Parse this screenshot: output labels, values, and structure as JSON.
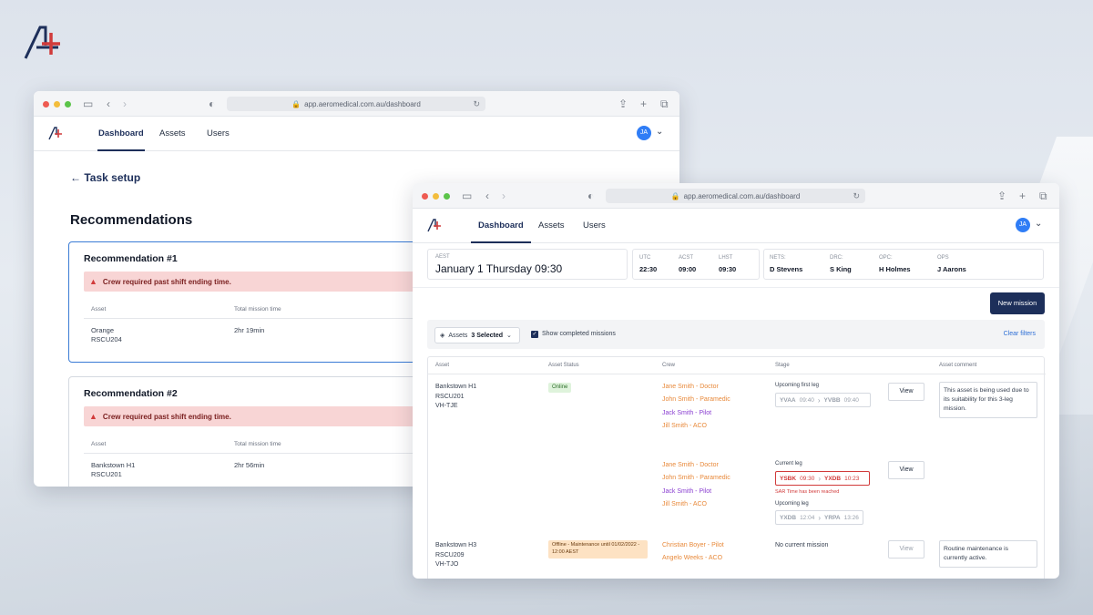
{
  "background": {
    "accent": "#1d2f5a",
    "brand_red": "#d13b3b"
  },
  "brand": {
    "logo_icon": "aeromedical-logo"
  },
  "back_window": {
    "url": "app.aeromedical.com.au/dashboard",
    "nav": {
      "tabs": [
        "Dashboard",
        "Assets",
        "Users"
      ],
      "active": "Dashboard",
      "avatar": "JA"
    },
    "back_link": "Task setup",
    "page_title": "Recommendations",
    "recommendations": [
      {
        "title": "Recommendation #1",
        "alert": "Crew required past shift ending time.",
        "col_asset": "Asset",
        "col_time": "Total mission time",
        "asset_name": "Orange",
        "asset_code": "RSCU204",
        "time": "2hr 19min"
      },
      {
        "title": "Recommendation #2",
        "alert": "Crew required past shift ending time.",
        "col_asset": "Asset",
        "col_time": "Total mission time",
        "asset_name": "Bankstown H1",
        "asset_code": "RSCU201",
        "time": "2hr 56min"
      }
    ]
  },
  "front_window": {
    "url": "app.aeromedical.com.au/dashboard",
    "nav": {
      "tabs": [
        "Dashboard",
        "Assets",
        "Users"
      ],
      "active": "Dashboard",
      "avatar": "JA"
    },
    "clock": {
      "main_label": "AEST",
      "main_value": "January 1 Thursday 09:30",
      "zones": [
        {
          "label": "UTC",
          "value": "22:30"
        },
        {
          "label": "ACST",
          "value": "09:00"
        },
        {
          "label": "LHST",
          "value": "09:30"
        }
      ],
      "roles": [
        {
          "label": "NETS:",
          "value": "D Stevens"
        },
        {
          "label": "DRC:",
          "value": "S King"
        },
        {
          "label": "OPC:",
          "value": "H Holmes"
        },
        {
          "label": "OPS",
          "value": "J Aarons"
        }
      ]
    },
    "new_mission_button": "New mission",
    "filters": {
      "assets_label": "Assets",
      "assets_selected": "3 Selected",
      "show_completed_label": "Show completed missions",
      "show_completed_checked": true,
      "clear_filters": "Clear filters"
    },
    "table": {
      "headers": [
        "Asset",
        "Asset Status",
        "Crew",
        "Stage",
        "Asset comment"
      ],
      "rows": [
        {
          "asset": [
            "Bankstown H1",
            "RSCU201",
            "VH-TJE"
          ],
          "status": "Online",
          "crew_a": [
            {
              "text": "Jane Smith - Doctor",
              "color": "orange"
            },
            {
              "text": "John Smith - Paramedic",
              "color": "orange"
            },
            {
              "text": "Jack Smith - Pilot",
              "color": "purple"
            },
            {
              "text": "Jill Smith - ACO",
              "color": "orange"
            }
          ],
          "stage_a": {
            "label": "Upcoming first leg",
            "from": "YVAA",
            "from_time": "09:40",
            "to": "YVBB",
            "to_time": "09:40"
          },
          "view_a": "View",
          "comment": "This asset is being used due to its suitability for this 3-leg mission.",
          "crew_b": [
            {
              "text": "Jane Smith - Doctor",
              "color": "orange"
            },
            {
              "text": "John Smith - Paramedic",
              "color": "orange"
            },
            {
              "text": "Jack Smith - Pilot",
              "color": "purple"
            },
            {
              "text": "Jill Smith - ACO",
              "color": "orange"
            }
          ],
          "stage_b": {
            "label": "Current leg",
            "from": "YSBK",
            "from_time": "09:30",
            "to": "YXDB",
            "to_time": "10:23",
            "warning": "SAR Time has been reached",
            "next_label": "Upcoming leg",
            "next_from": "YXDB",
            "next_from_time": "12:04",
            "next_to": "YRPA",
            "next_to_time": "13:26"
          },
          "view_b": "View"
        },
        {
          "asset": [
            "Bankstown H3",
            "RSCU209",
            "VH-TJO"
          ],
          "status": "Offline - Maintenance until 01/02/2022 - 12:00 AEST",
          "crew": [
            {
              "text": "Christian Boyer - Pilot",
              "color": "orange"
            },
            {
              "text": "Angelo Weeks - ACO",
              "color": "orange"
            }
          ],
          "stage": "No current mission",
          "view": "View",
          "comment": "Routine maintenance is currently active."
        }
      ]
    }
  }
}
